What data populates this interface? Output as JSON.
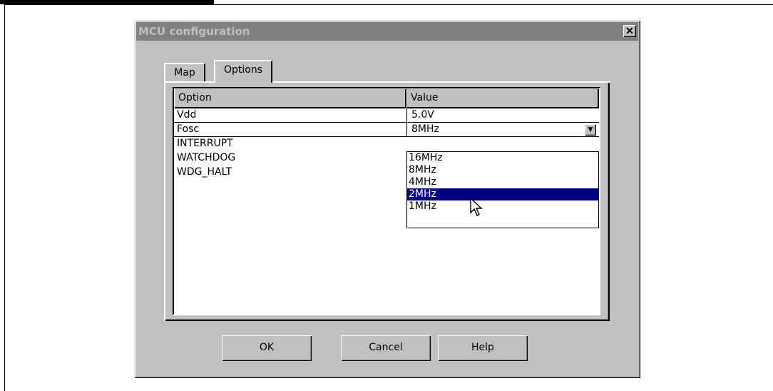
{
  "dialog": {
    "title": "MCU configuration",
    "close_label": "✕"
  },
  "tabs": [
    {
      "label": "Map"
    },
    {
      "label": "Options"
    }
  ],
  "grid": {
    "headers": [
      "Option",
      "Value"
    ],
    "rows": [
      {
        "option": "Vdd",
        "value": "5.0V"
      },
      {
        "option": "Fosc",
        "value": "8MHz"
      },
      {
        "option": "INTERRUPT",
        "value": ""
      },
      {
        "option": "WATCHDOG",
        "value": ""
      },
      {
        "option": "WDG_HALT",
        "value": ""
      }
    ]
  },
  "dropdown": {
    "options": [
      "16MHz",
      "8MHz",
      "4MHz",
      "2MHz",
      "1MHz"
    ],
    "highlighted": "2MHz"
  },
  "buttons": {
    "ok": "OK",
    "cancel": "Cancel",
    "help": "Help"
  },
  "icons": {
    "close": "close-icon",
    "combo_arrow": "chevron-down-icon",
    "cursor": "mouse-pointer-icon"
  },
  "colors": {
    "face": "#c0c0c0",
    "titlebar_inactive": "#808080",
    "selection": "#000080"
  }
}
